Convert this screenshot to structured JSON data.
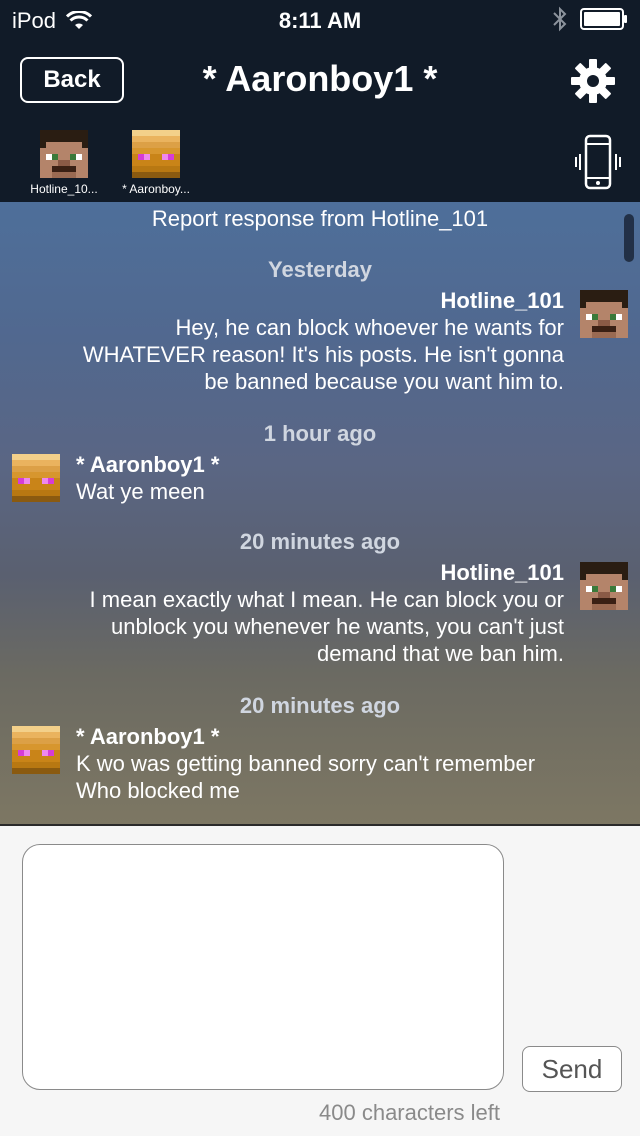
{
  "status_bar": {
    "device": "iPod",
    "time": "8:11 AM",
    "icons": [
      "wifi-icon",
      "bluetooth-icon",
      "battery-icon"
    ]
  },
  "nav": {
    "back_label": "Back",
    "title": "* Aaronboy1 *",
    "settings_icon": "gear-icon"
  },
  "participants": [
    {
      "label": "Hotline_10...",
      "avatar": "steve-face-avatar"
    },
    {
      "label": "* Aaronboy...",
      "avatar": "enderman-face-avatar"
    }
  ],
  "vibrate_icon": "phone-vibrate-icon",
  "chat": {
    "report_line": "Report response from Hotline_101",
    "messages": [
      {
        "timestamp": "Yesterday",
        "sender": "Hotline_101",
        "side": "right",
        "lines": [
          "Hey, he can block whoever he wants for",
          "WHATEVER reason! It's his posts. He isn't gonna",
          "be banned because you want him to."
        ]
      },
      {
        "timestamp": "1 hour ago",
        "sender": "* Aaronboy1 *",
        "side": "left",
        "lines": [
          "Wat ye meen"
        ]
      },
      {
        "timestamp": "20 minutes ago",
        "sender": "Hotline_101",
        "side": "right",
        "lines": [
          "I mean exactly what I mean. He can block you or",
          "unblock you whenever he wants, you can't just",
          "demand that we ban him."
        ]
      },
      {
        "timestamp": "20 minutes ago",
        "sender": "* Aaronboy1 *",
        "side": "left",
        "lines": [
          "K wo was getting banned sorry can't remember",
          "Who blocked me"
        ]
      }
    ]
  },
  "compose": {
    "placeholder": "",
    "send_label": "Send",
    "chars_left": "400 characters left"
  },
  "colors": {
    "bar_bg": "#111b28",
    "chat_top": "#4e6f9a",
    "chat_bottom": "#7d7763"
  }
}
